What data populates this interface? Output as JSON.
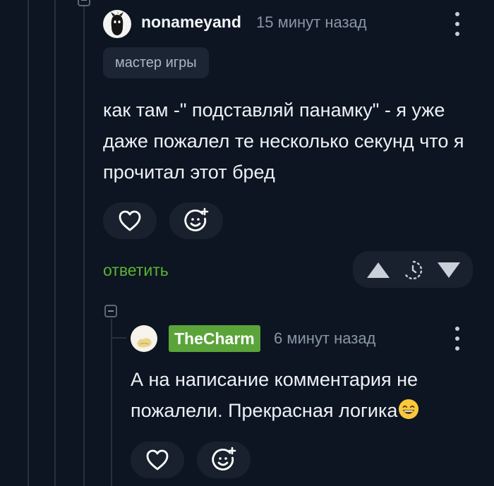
{
  "comment1": {
    "username": "nonameyand",
    "time": "15 минут назад",
    "tag": "мастер игры",
    "text": "как там -\" подставляй панамку\" - я уже даже пожалел те несколько секунд что я прочитал этот бред",
    "reply_label": "ответить"
  },
  "comment2": {
    "username": "TheCharm",
    "time": "6 минут назад",
    "text": "А на написание комментария не пожалели. Прекрасная логика"
  },
  "icons": {
    "like": "heart-icon",
    "react": "smiley-plus-icon",
    "upvote": "triangle-up-icon",
    "history": "clock-history-icon",
    "downvote": "triangle-down-icon",
    "menu": "kebab-menu-icon",
    "collapse": "collapse-minus-icon",
    "emoji": "grinning-face-emoji"
  },
  "colors": {
    "background": "#0c1521",
    "reply_link": "#5bb332",
    "username_badge": "#5aa43a",
    "button_bg": "#18212d"
  }
}
